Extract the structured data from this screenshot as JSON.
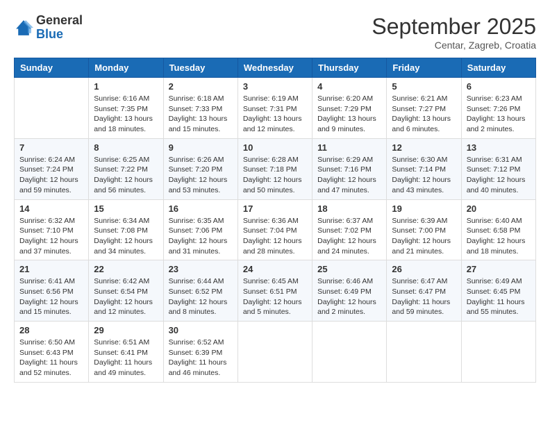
{
  "header": {
    "logo": {
      "general": "General",
      "blue": "Blue"
    },
    "title": "September 2025",
    "location": "Centar, Zagreb, Croatia"
  },
  "calendar": {
    "days_of_week": [
      "Sunday",
      "Monday",
      "Tuesday",
      "Wednesday",
      "Thursday",
      "Friday",
      "Saturday"
    ],
    "weeks": [
      [
        {
          "day": "",
          "info": ""
        },
        {
          "day": "1",
          "info": "Sunrise: 6:16 AM\nSunset: 7:35 PM\nDaylight: 13 hours\nand 18 minutes."
        },
        {
          "day": "2",
          "info": "Sunrise: 6:18 AM\nSunset: 7:33 PM\nDaylight: 13 hours\nand 15 minutes."
        },
        {
          "day": "3",
          "info": "Sunrise: 6:19 AM\nSunset: 7:31 PM\nDaylight: 13 hours\nand 12 minutes."
        },
        {
          "day": "4",
          "info": "Sunrise: 6:20 AM\nSunset: 7:29 PM\nDaylight: 13 hours\nand 9 minutes."
        },
        {
          "day": "5",
          "info": "Sunrise: 6:21 AM\nSunset: 7:27 PM\nDaylight: 13 hours\nand 6 minutes."
        },
        {
          "day": "6",
          "info": "Sunrise: 6:23 AM\nSunset: 7:26 PM\nDaylight: 13 hours\nand 2 minutes."
        }
      ],
      [
        {
          "day": "7",
          "info": "Sunrise: 6:24 AM\nSunset: 7:24 PM\nDaylight: 12 hours\nand 59 minutes."
        },
        {
          "day": "8",
          "info": "Sunrise: 6:25 AM\nSunset: 7:22 PM\nDaylight: 12 hours\nand 56 minutes."
        },
        {
          "day": "9",
          "info": "Sunrise: 6:26 AM\nSunset: 7:20 PM\nDaylight: 12 hours\nand 53 minutes."
        },
        {
          "day": "10",
          "info": "Sunrise: 6:28 AM\nSunset: 7:18 PM\nDaylight: 12 hours\nand 50 minutes."
        },
        {
          "day": "11",
          "info": "Sunrise: 6:29 AM\nSunset: 7:16 PM\nDaylight: 12 hours\nand 47 minutes."
        },
        {
          "day": "12",
          "info": "Sunrise: 6:30 AM\nSunset: 7:14 PM\nDaylight: 12 hours\nand 43 minutes."
        },
        {
          "day": "13",
          "info": "Sunrise: 6:31 AM\nSunset: 7:12 PM\nDaylight: 12 hours\nand 40 minutes."
        }
      ],
      [
        {
          "day": "14",
          "info": "Sunrise: 6:32 AM\nSunset: 7:10 PM\nDaylight: 12 hours\nand 37 minutes."
        },
        {
          "day": "15",
          "info": "Sunrise: 6:34 AM\nSunset: 7:08 PM\nDaylight: 12 hours\nand 34 minutes."
        },
        {
          "day": "16",
          "info": "Sunrise: 6:35 AM\nSunset: 7:06 PM\nDaylight: 12 hours\nand 31 minutes."
        },
        {
          "day": "17",
          "info": "Sunrise: 6:36 AM\nSunset: 7:04 PM\nDaylight: 12 hours\nand 28 minutes."
        },
        {
          "day": "18",
          "info": "Sunrise: 6:37 AM\nSunset: 7:02 PM\nDaylight: 12 hours\nand 24 minutes."
        },
        {
          "day": "19",
          "info": "Sunrise: 6:39 AM\nSunset: 7:00 PM\nDaylight: 12 hours\nand 21 minutes."
        },
        {
          "day": "20",
          "info": "Sunrise: 6:40 AM\nSunset: 6:58 PM\nDaylight: 12 hours\nand 18 minutes."
        }
      ],
      [
        {
          "day": "21",
          "info": "Sunrise: 6:41 AM\nSunset: 6:56 PM\nDaylight: 12 hours\nand 15 minutes."
        },
        {
          "day": "22",
          "info": "Sunrise: 6:42 AM\nSunset: 6:54 PM\nDaylight: 12 hours\nand 12 minutes."
        },
        {
          "day": "23",
          "info": "Sunrise: 6:44 AM\nSunset: 6:52 PM\nDaylight: 12 hours\nand 8 minutes."
        },
        {
          "day": "24",
          "info": "Sunrise: 6:45 AM\nSunset: 6:51 PM\nDaylight: 12 hours\nand 5 minutes."
        },
        {
          "day": "25",
          "info": "Sunrise: 6:46 AM\nSunset: 6:49 PM\nDaylight: 12 hours\nand 2 minutes."
        },
        {
          "day": "26",
          "info": "Sunrise: 6:47 AM\nSunset: 6:47 PM\nDaylight: 11 hours\nand 59 minutes."
        },
        {
          "day": "27",
          "info": "Sunrise: 6:49 AM\nSunset: 6:45 PM\nDaylight: 11 hours\nand 55 minutes."
        }
      ],
      [
        {
          "day": "28",
          "info": "Sunrise: 6:50 AM\nSunset: 6:43 PM\nDaylight: 11 hours\nand 52 minutes."
        },
        {
          "day": "29",
          "info": "Sunrise: 6:51 AM\nSunset: 6:41 PM\nDaylight: 11 hours\nand 49 minutes."
        },
        {
          "day": "30",
          "info": "Sunrise: 6:52 AM\nSunset: 6:39 PM\nDaylight: 11 hours\nand 46 minutes."
        },
        {
          "day": "",
          "info": ""
        },
        {
          "day": "",
          "info": ""
        },
        {
          "day": "",
          "info": ""
        },
        {
          "day": "",
          "info": ""
        }
      ]
    ]
  }
}
